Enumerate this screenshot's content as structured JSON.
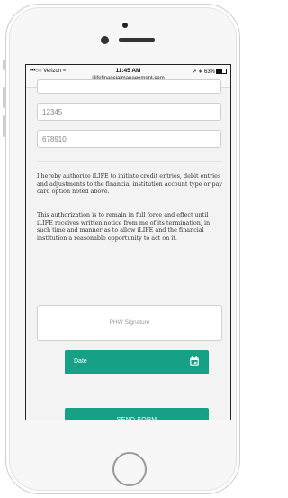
{
  "status_bar": {
    "carrier": "•••○○ Verizon",
    "time": "11:45 AM",
    "url": "iilifefinancialmanagement.com",
    "battery": "63%"
  },
  "form": {
    "field_1_value": "12345",
    "field_2_value": "678910",
    "authorization_text": "I hereby authorize iLIFE to initiate credit entries, debit entries and adjustments to the financial institution account type or pay card option noted above.",
    "authorization_duration_text": "This authorization is to remain in full force and effect until iLIFE receives written notice from me of its termination, in such time and manner as to allow iLIFE and the financial institution a reasonable opportunity to act on it.",
    "signature_placeholder": "PHW Signature",
    "date_label": "Date",
    "send_button_label": "SEND FORM"
  },
  "colors": {
    "accent": "#16a085"
  }
}
